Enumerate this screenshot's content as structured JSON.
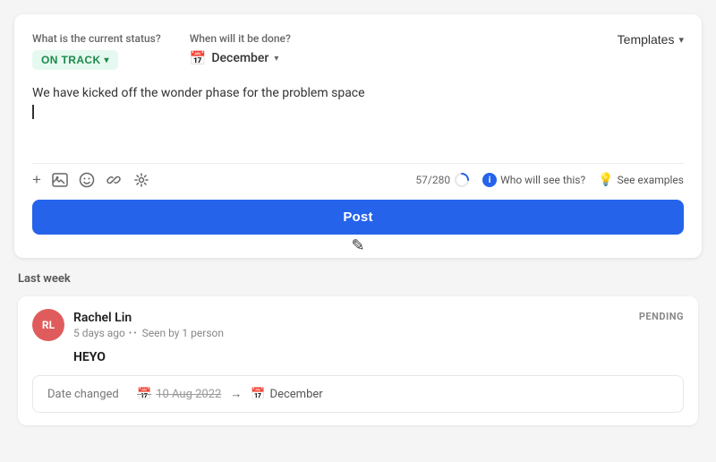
{
  "page": {
    "background_color": "#f5f5f5"
  },
  "post_card": {
    "status_section_label": "What is the current status?",
    "status_value": "ON TRACK",
    "date_section_label": "When will it be done?",
    "date_value": "December",
    "templates_label": "Templates",
    "text_content": "We have kicked off the wonder phase for the problem space",
    "char_count": "57/280",
    "who_sees_label": "Who will see this?",
    "see_examples_label": "See examples",
    "post_button_label": "Post"
  },
  "history": {
    "section_label": "Last week",
    "items": [
      {
        "avatar_initials": "RL",
        "avatar_color": "#e05c5c",
        "author_name": "Rachel Lin",
        "time_ago": "5 days ago",
        "seen_text": "Seen by 1 person",
        "status_badge": "PENDING",
        "content": "HEYO",
        "date_changed_label": "Date changed",
        "date_from": "10 Aug 2022",
        "date_to": "December"
      }
    ]
  },
  "icons": {
    "plus": "+",
    "image": "🖼",
    "emoji": "😊",
    "link": "🔗",
    "sparkle": "✳",
    "info": "i",
    "bulb": "💡",
    "calendar": "📅",
    "chevron_down": "▾",
    "arrow_right": "→",
    "dots": "••"
  }
}
